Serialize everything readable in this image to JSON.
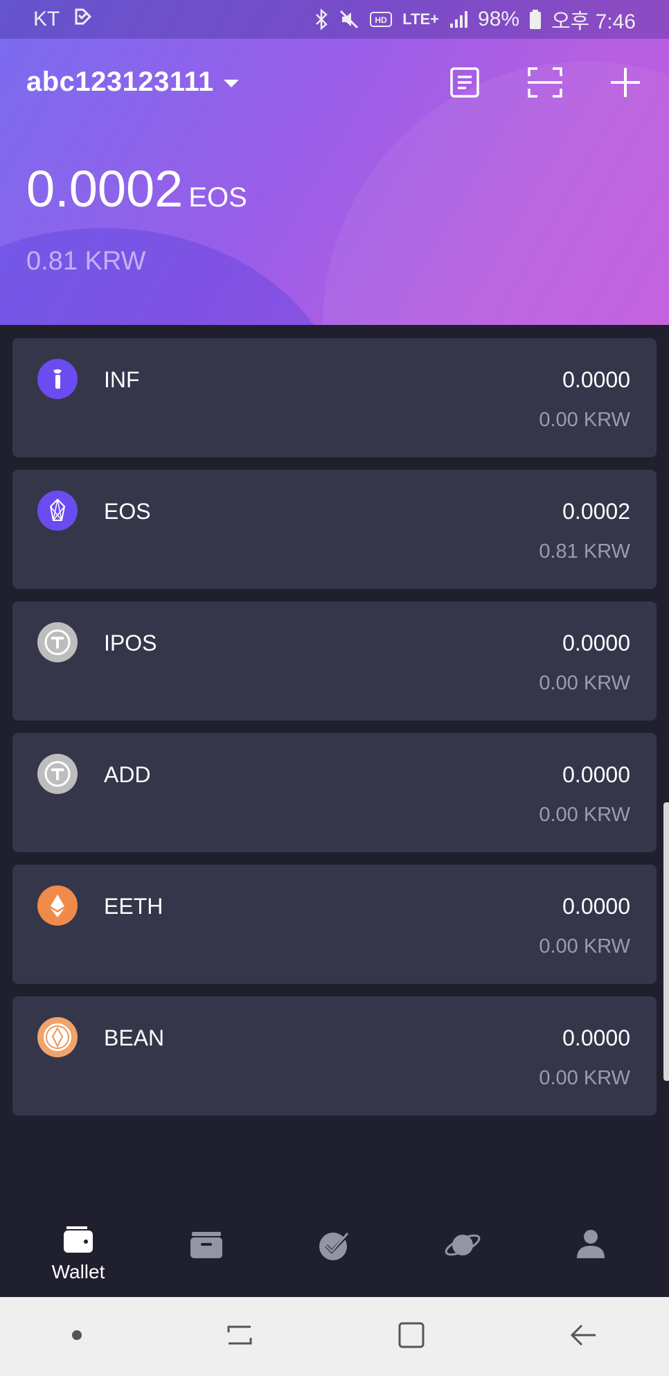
{
  "status_bar": {
    "carrier": "KT",
    "network": "LTE+",
    "battery": "98%",
    "time": "오후 7:46"
  },
  "header": {
    "account_name": "abc123123111",
    "balance_value": "0.0002",
    "balance_unit": "EOS",
    "fiat_value": "0.81 KRW"
  },
  "tokens": [
    {
      "name": "INF",
      "amount": "0.0000",
      "fiat": "0.00 KRW",
      "icon": "inf-token-icon",
      "color": "#6a4cf0"
    },
    {
      "name": "EOS",
      "amount": "0.0002",
      "fiat": "0.81 KRW",
      "icon": "eos-token-icon",
      "color": "#6a4cf0"
    },
    {
      "name": "IPOS",
      "amount": "0.0000",
      "fiat": "0.00 KRW",
      "icon": "generic-token-icon",
      "color": "#bdbdbd"
    },
    {
      "name": "ADD",
      "amount": "0.0000",
      "fiat": "0.00 KRW",
      "icon": "generic-token-icon",
      "color": "#bdbdbd"
    },
    {
      "name": "EETH",
      "amount": "0.0000",
      "fiat": "0.00 KRW",
      "icon": "eeth-token-icon",
      "color": "#f08a4b"
    },
    {
      "name": "BEAN",
      "amount": "0.0000",
      "fiat": "0.00 KRW",
      "icon": "bean-token-icon",
      "color": "#f0a36a"
    }
  ],
  "bottom_nav": {
    "wallet_label": "Wallet"
  },
  "colors": {
    "background": "#1f1f2e",
    "card": "#35364a",
    "accent": "#9a5ee8"
  }
}
